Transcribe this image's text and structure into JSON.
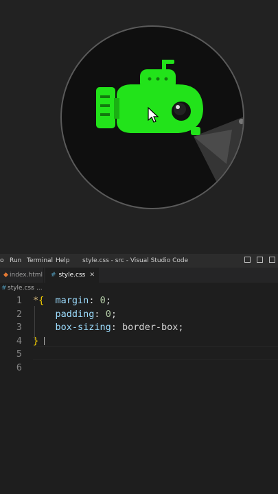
{
  "window_title": "style.css - src - Visual Studio Code",
  "menu": [
    "o",
    "Run",
    "Terminal",
    "Help"
  ],
  "tabs": [
    {
      "label": "index.html",
      "active": false
    },
    {
      "label": "style.css",
      "active": true,
      "close": "✕"
    }
  ],
  "breadcrumb": {
    "file": "style.css",
    "sep": "›",
    "more": "..."
  },
  "code_lines": [
    {
      "n": "1",
      "parts": [
        {
          "t": "*",
          "c": "star"
        },
        {
          "t": "{",
          "c": "brace"
        },
        {
          "t": "  ",
          "c": "plain"
        },
        {
          "t": "margin",
          "c": "prop"
        },
        {
          "t": ": ",
          "c": "plain"
        },
        {
          "t": "0",
          "c": "num"
        },
        {
          "t": ";",
          "c": "plain"
        }
      ]
    },
    {
      "n": "2",
      "parts": [
        {
          "t": "    ",
          "c": "plain"
        },
        {
          "t": "padding",
          "c": "prop"
        },
        {
          "t": ": ",
          "c": "plain"
        },
        {
          "t": "0",
          "c": "num"
        },
        {
          "t": ";",
          "c": "plain"
        }
      ]
    },
    {
      "n": "3",
      "parts": [
        {
          "t": "    ",
          "c": "plain"
        },
        {
          "t": "box-sizing",
          "c": "prop"
        },
        {
          "t": ": border-box;",
          "c": "plain"
        }
      ]
    },
    {
      "n": "4",
      "parts": [
        {
          "t": "}",
          "c": "brace"
        }
      ]
    },
    {
      "n": "5",
      "parts": []
    },
    {
      "n": "6",
      "parts": []
    }
  ],
  "colors": {
    "sub_green": "#22e31a",
    "editor_bg": "#1e1e1e",
    "accent_blue": "#519aba"
  },
  "icons": [
    "submarine-icon",
    "mouse-pointer-icon",
    "html-file-icon",
    "css-file-icon",
    "close-icon",
    "layout-icon"
  ]
}
